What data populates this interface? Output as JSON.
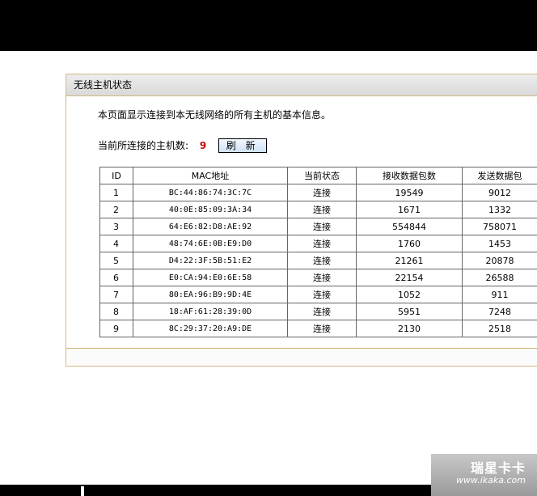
{
  "panel": {
    "title": "无线主机状态",
    "description": "本页面显示连接到本无线网络的所有主机的基本信息。",
    "count_label": "当前所连接的主机数:",
    "count_value": "9",
    "refresh_label": "刷 新"
  },
  "table": {
    "headers": {
      "id": "ID",
      "mac": "MAC地址",
      "status": "当前状态",
      "rx": "接收数据包数",
      "tx": "发送数据包"
    },
    "rows": [
      {
        "id": "1",
        "mac": "BC:44:86:74:3C:7C",
        "status": "连接",
        "rx": "19549",
        "tx": "9012"
      },
      {
        "id": "2",
        "mac": "40:0E:85:09:3A:34",
        "status": "连接",
        "rx": "1671",
        "tx": "1332"
      },
      {
        "id": "3",
        "mac": "64:E6:82:D8:AE:92",
        "status": "连接",
        "rx": "554844",
        "tx": "758071"
      },
      {
        "id": "4",
        "mac": "48:74:6E:0B:E9:D0",
        "status": "连接",
        "rx": "1760",
        "tx": "1453"
      },
      {
        "id": "5",
        "mac": "D4:22:3F:5B:51:E2",
        "status": "连接",
        "rx": "21261",
        "tx": "20878"
      },
      {
        "id": "6",
        "mac": "E0:CA:94:E0:6E:58",
        "status": "连接",
        "rx": "22154",
        "tx": "26588"
      },
      {
        "id": "7",
        "mac": "80:EA:96:B9:9D:4E",
        "status": "连接",
        "rx": "1052",
        "tx": "911"
      },
      {
        "id": "8",
        "mac": "18:AF:61:28:39:0D",
        "status": "连接",
        "rx": "5951",
        "tx": "7248"
      },
      {
        "id": "9",
        "mac": "8C:29:37:20:A9:DE",
        "status": "连接",
        "rx": "2130",
        "tx": "2518"
      }
    ]
  },
  "watermark": {
    "brand": "瑞星卡卡",
    "url": "www.ikaka.com"
  }
}
